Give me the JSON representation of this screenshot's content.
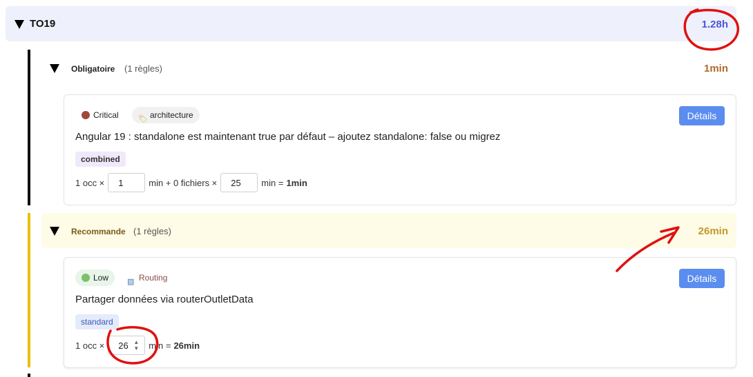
{
  "group": {
    "title": "TO19",
    "total": "1.28h"
  },
  "sections": [
    {
      "title": "Obligatoire",
      "count": "(1 règles)",
      "total": "1min",
      "rule": {
        "severity": "Critical",
        "category": "architecture",
        "title": "Angular 19 : standalone est maintenant true par défaut – ajoutez standalone: false ou migrez",
        "badge": "combined",
        "occ": "1 occ ×",
        "min_value": "1",
        "min_text": "min + 0 fichiers ×",
        "files_value": "25",
        "eq_text": "min =",
        "result": "1min",
        "details": "Détails"
      }
    },
    {
      "title": "Recommande",
      "count": "(1 règles)",
      "total": "26min",
      "rule": {
        "severity": "Low",
        "category": "Routing",
        "title": "Partager données via routerOutletData",
        "badge": "standard",
        "occ": "1 occ ×",
        "min_value": "26",
        "eq_text": "min =",
        "result": "26min",
        "details": "Détails"
      }
    }
  ],
  "colors": {
    "group_bg": "#eef0fb",
    "group_total": "#4a57d8",
    "obligatoire": "#222222",
    "obligatoire_total": "#b06a2c",
    "recommande": "#7a5a1a",
    "recommande_total": "#c09a2a",
    "details_button": "#5b8def",
    "annotation": "#e01010"
  }
}
